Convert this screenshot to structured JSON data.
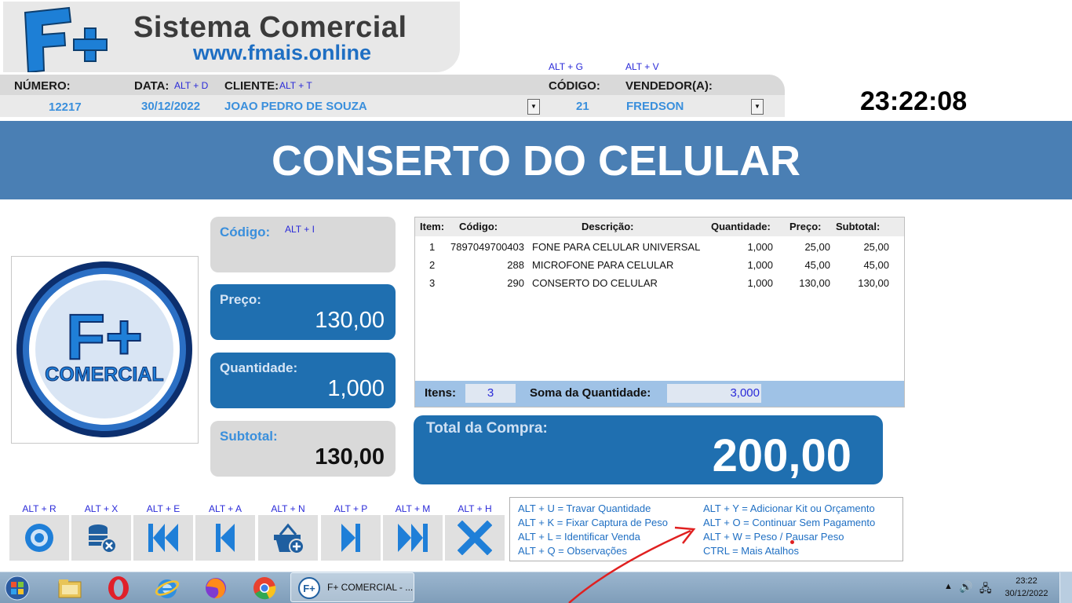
{
  "app": {
    "title_main": "Sistema Comercial",
    "title_url": "www.fmais.online",
    "logo_text": "F+"
  },
  "header": {
    "hints_top": {
      "codigo": "ALT + G",
      "vendedor": "ALT + V"
    },
    "numero_label": "NÚMERO:",
    "data_label": "DATA:",
    "data_hint": "ALT + D",
    "cliente_label": "CLIENTE:",
    "cliente_hint": "ALT + T",
    "codigo_label": "CÓDIGO:",
    "vendedor_label": "VENDEDOR(A):",
    "numero": "12217",
    "data": "30/12/2022",
    "cliente": "JOAO PEDRO DE SOUZA",
    "codigo": "21",
    "vendedor": "FREDSON",
    "clock": "23:22:08"
  },
  "banner": "CONSERTO DO CELULAR",
  "logo_card": {
    "f_plus": "F+",
    "comercial": "COMERCIAL"
  },
  "cards": {
    "codigo_label": "Código:",
    "codigo_hint": "ALT + I",
    "preco_label": "Preço:",
    "preco_value": "130,00",
    "quantidade_label": "Quantidade:",
    "quantidade_value": "1,000",
    "subtotal_label": "Subtotal:",
    "subtotal_value": "130,00"
  },
  "table": {
    "headers": [
      "Item:",
      "Código:",
      "Descrição:",
      "Quantidade:",
      "Preço:",
      "Subtotal:"
    ],
    "rows": [
      [
        "1",
        "7897049700403",
        "FONE PARA CELULAR UNIVERSAL",
        "1,000",
        "25,00",
        "25,00"
      ],
      [
        "2",
        "288",
        "MICROFONE PARA CELULAR",
        "1,000",
        "45,00",
        "45,00"
      ],
      [
        "3",
        "290",
        "CONSERTO DO CELULAR",
        "1,000",
        "130,00",
        "130,00"
      ]
    ],
    "itens_label": "Itens:",
    "itens_value": "3",
    "soma_label": "Soma da Quantidade:",
    "soma_value": "3,000"
  },
  "total": {
    "label": "Total da Compra:",
    "value": "200,00"
  },
  "toolbar": [
    {
      "hint": "ALT + R",
      "icon": "disc-icon"
    },
    {
      "hint": "ALT + X",
      "icon": "database-remove-icon"
    },
    {
      "hint": "ALT + E",
      "icon": "skip-first-icon"
    },
    {
      "hint": "ALT + A",
      "icon": "step-back-icon"
    },
    {
      "hint": "ALT + N",
      "icon": "basket-add-icon"
    },
    {
      "hint": "ALT + P",
      "icon": "step-forward-icon"
    },
    {
      "hint": "ALT + M",
      "icon": "skip-last-icon"
    },
    {
      "hint": "ALT + H",
      "icon": "close-icon"
    }
  ],
  "shortcuts": [
    "ALT + U = Travar Quantidade",
    "ALT + K = Fixar Captura de Peso",
    "ALT + L = Identificar Venda",
    "ALT + Q = Observações",
    "ALT + Y = Adicionar Kit ou Orçamento",
    "ALT + O = Continuar Sem Pagamento",
    "ALT + W = Peso / Pausar Peso",
    "CTRL = Mais Atalhos"
  ],
  "taskbar": {
    "window_label": "F+ COMERCIAL - ...",
    "time": "23:22",
    "date": "30/12/2022"
  },
  "colors": {
    "banner": "#4a7fb4",
    "card_blue": "#1f6fb0",
    "accent": "#1f6fc3",
    "annotation_arrow": "#e02020"
  }
}
